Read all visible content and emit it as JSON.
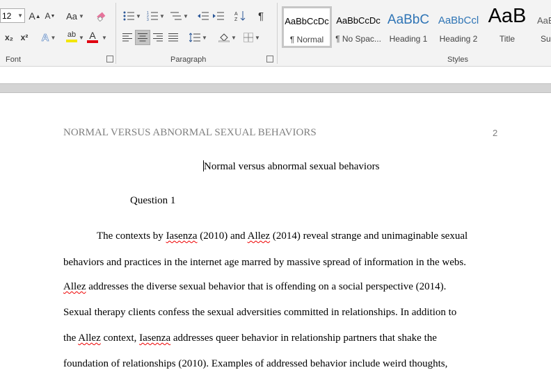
{
  "font_group": {
    "label": "Font",
    "font_size": "12",
    "grow_label": "A",
    "shrink_label": "A",
    "case_label": "Aa",
    "subscript_label": "x₂",
    "superscript_label": "x²",
    "text_effects_label": "A",
    "highlight_label": "ab",
    "font_color_label": "A",
    "font_color": "#e0000f",
    "highlight_color": "#f2e600"
  },
  "paragraph_group": {
    "label": "Paragraph",
    "pilcrow_label": "¶"
  },
  "styles_group": {
    "label": "Styles",
    "items": [
      {
        "preview": "AaBbCcDc",
        "name": "¶ Normal"
      },
      {
        "preview": "AaBbCcDc",
        "name": "¶ No Spac..."
      },
      {
        "preview": "AaBbC",
        "name": "Heading 1"
      },
      {
        "preview": "AaBbCcl",
        "name": "Heading 2"
      },
      {
        "preview": "AaB",
        "name": "Title"
      },
      {
        "preview": "AaB",
        "name": "Su"
      }
    ],
    "heading_color": "#2e74b5"
  },
  "document": {
    "running_head": "NORMAL VERSUS ABNORMAL SEXUAL BEHAVIORS",
    "page_number": "2",
    "title": "Normal versus abnormal sexual behaviors",
    "question": "Question 1",
    "lines": [
      {
        "a": "The contexts by ",
        "s1": "Iasenza",
        "b": " (2010) and ",
        "s2": "Allez",
        "c": " (2014) reveal strange and unimaginable sexual"
      },
      {
        "a": "behaviors and practices in the internet age marred by massive spread of information in the webs."
      },
      {
        "s1": "Allez",
        "a": " addresses the diverse sexual behavior that is offending on a social perspective (2014)."
      },
      {
        "a": "Sexual therapy clients confess the sexual adversities committed in relationships. In addition to"
      },
      {
        "a": "the ",
        "s1": "Allez",
        "b": " context, ",
        "s2": "Iasenza",
        "c": " addresses queer behavior in relationship partners that shake the"
      },
      {
        "a": "foundation of relationships (2010). Examples of addressed behavior include weird thoughts,"
      }
    ]
  }
}
